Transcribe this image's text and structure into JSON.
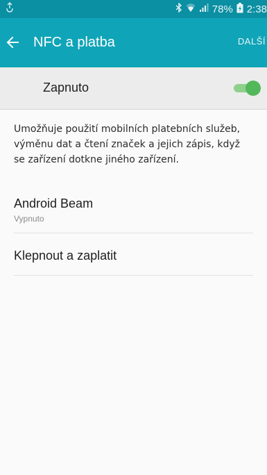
{
  "status_bar": {
    "battery_percent": "78%",
    "time": "2:38",
    "icons": [
      "notification-icon",
      "bluetooth-icon",
      "wifi-icon",
      "signal-icon",
      "battery-charging-icon"
    ]
  },
  "app_bar": {
    "title": "NFC a platba",
    "more_label": "DALŠÍ",
    "back_icon": "arrow-left-icon"
  },
  "master_switch": {
    "label": "Zapnuto",
    "state": "on"
  },
  "description": {
    "lines": [
      "Umožňuje použití mobilních platebních služeb,",
      "výměnu dat a čtení značek a jejich zápis, když",
      "se zařízení dotkne jiného zařízení."
    ]
  },
  "items": [
    {
      "title": "Android Beam",
      "subtitle": "Vypnuto"
    },
    {
      "title": "Klepnout a zaplatit"
    }
  ],
  "colors": {
    "status_bar": "#0b8fa2",
    "app_bar": "#10a4b8",
    "switch_row_bg": "#ececec",
    "toggle_on": "#52b85a",
    "toggle_track": "#8ed08d"
  }
}
